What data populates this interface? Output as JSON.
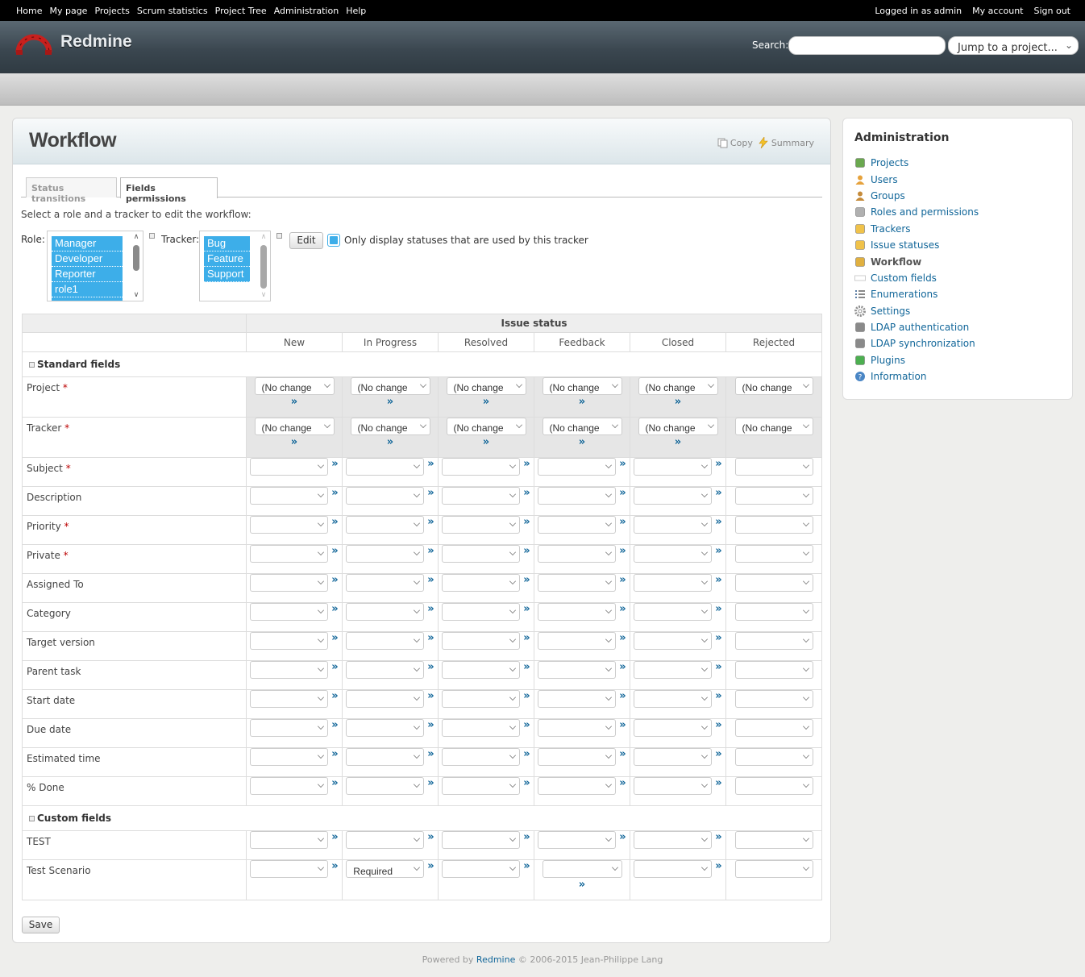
{
  "top_menu": {
    "left": [
      "Home",
      "My page",
      "Projects",
      "Scrum statistics",
      "Project Tree",
      "Administration",
      "Help"
    ],
    "logged_as": "Logged in as admin",
    "my_account": "My account",
    "sign_out": "Sign out"
  },
  "header": {
    "title": "Redmine",
    "search_label": "Search:",
    "search_value": "",
    "jump_placeholder": "Jump to a project..."
  },
  "page": {
    "title": "Workflow",
    "copy": "Copy",
    "summary": "Summary"
  },
  "tabs": [
    "Status transitions",
    "Fields permissions"
  ],
  "selected_tab": "Fields permissions",
  "intro": "Select a role and a tracker to edit the workflow:",
  "role_label": "Role:",
  "roles": [
    "Manager",
    "Developer",
    "Reporter",
    "role1"
  ],
  "tracker_label": "Tracker:",
  "trackers": [
    "Bug",
    "Feature",
    "Support"
  ],
  "edit_button": "Edit",
  "only_used_label": "Only display statuses that are used by this tracker",
  "table": {
    "issue_status_header": "Issue status",
    "statuses": [
      "New",
      "In Progress",
      "Resolved",
      "Feedback",
      "Closed",
      "Rejected"
    ],
    "standard_group": "Standard fields",
    "custom_group": "Custom fields",
    "no_change": "(No change",
    "raquo": "»",
    "standard_fields": [
      {
        "label": "Project",
        "required": true,
        "readonly_row": true
      },
      {
        "label": "Tracker",
        "required": true,
        "readonly_row": true
      },
      {
        "label": "Subject",
        "required": true
      },
      {
        "label": "Description",
        "required": false
      },
      {
        "label": "Priority",
        "required": true
      },
      {
        "label": "Private",
        "required": true
      },
      {
        "label": "Assigned To",
        "required": false
      },
      {
        "label": "Category",
        "required": false
      },
      {
        "label": "Target version",
        "required": false
      },
      {
        "label": "Parent task",
        "required": false
      },
      {
        "label": "Start date",
        "required": false
      },
      {
        "label": "Due date",
        "required": false
      },
      {
        "label": "Estimated time",
        "required": false
      },
      {
        "label": "% Done",
        "required": false
      }
    ],
    "custom_fields": [
      {
        "label": "TEST",
        "values": [
          "",
          "",
          "",
          "",
          "",
          ""
        ]
      },
      {
        "label": "Test Scenario",
        "values": [
          "",
          "Required",
          "",
          "",
          "",
          ""
        ]
      }
    ]
  },
  "save_button": "Save",
  "sidebar": {
    "title": "Administration",
    "items": [
      {
        "label": "Projects",
        "icon": "projects-icon",
        "selected": false
      },
      {
        "label": "Users",
        "icon": "user-icon",
        "selected": false
      },
      {
        "label": "Groups",
        "icon": "group-icon",
        "selected": false
      },
      {
        "label": "Roles and permissions",
        "icon": "roles-icon",
        "selected": false
      },
      {
        "label": "Trackers",
        "icon": "tracker-icon",
        "selected": false
      },
      {
        "label": "Issue statuses",
        "icon": "issue-status-icon",
        "selected": false
      },
      {
        "label": "Workflow",
        "icon": "workflow-icon",
        "selected": true
      },
      {
        "label": "Custom fields",
        "icon": "custom-fields-icon",
        "selected": false
      },
      {
        "label": "Enumerations",
        "icon": "list-icon",
        "selected": false
      },
      {
        "label": "Settings",
        "icon": "settings-icon",
        "selected": false
      },
      {
        "label": "LDAP authentication",
        "icon": "ldap-icon",
        "selected": false
      },
      {
        "label": "LDAP synchronization",
        "icon": "ldap-sync-icon",
        "selected": false
      },
      {
        "label": "Plugins",
        "icon": "plugin-icon",
        "selected": false
      },
      {
        "label": "Information",
        "icon": "info-icon",
        "selected": false
      }
    ]
  },
  "footer": {
    "powered_by": "Powered by",
    "link": "Redmine",
    "copyright": "© 2006-2015 Jean-Philippe Lang"
  },
  "colors": {
    "accent": "#3daee9",
    "link": "#116699",
    "required": "#bb0000"
  }
}
